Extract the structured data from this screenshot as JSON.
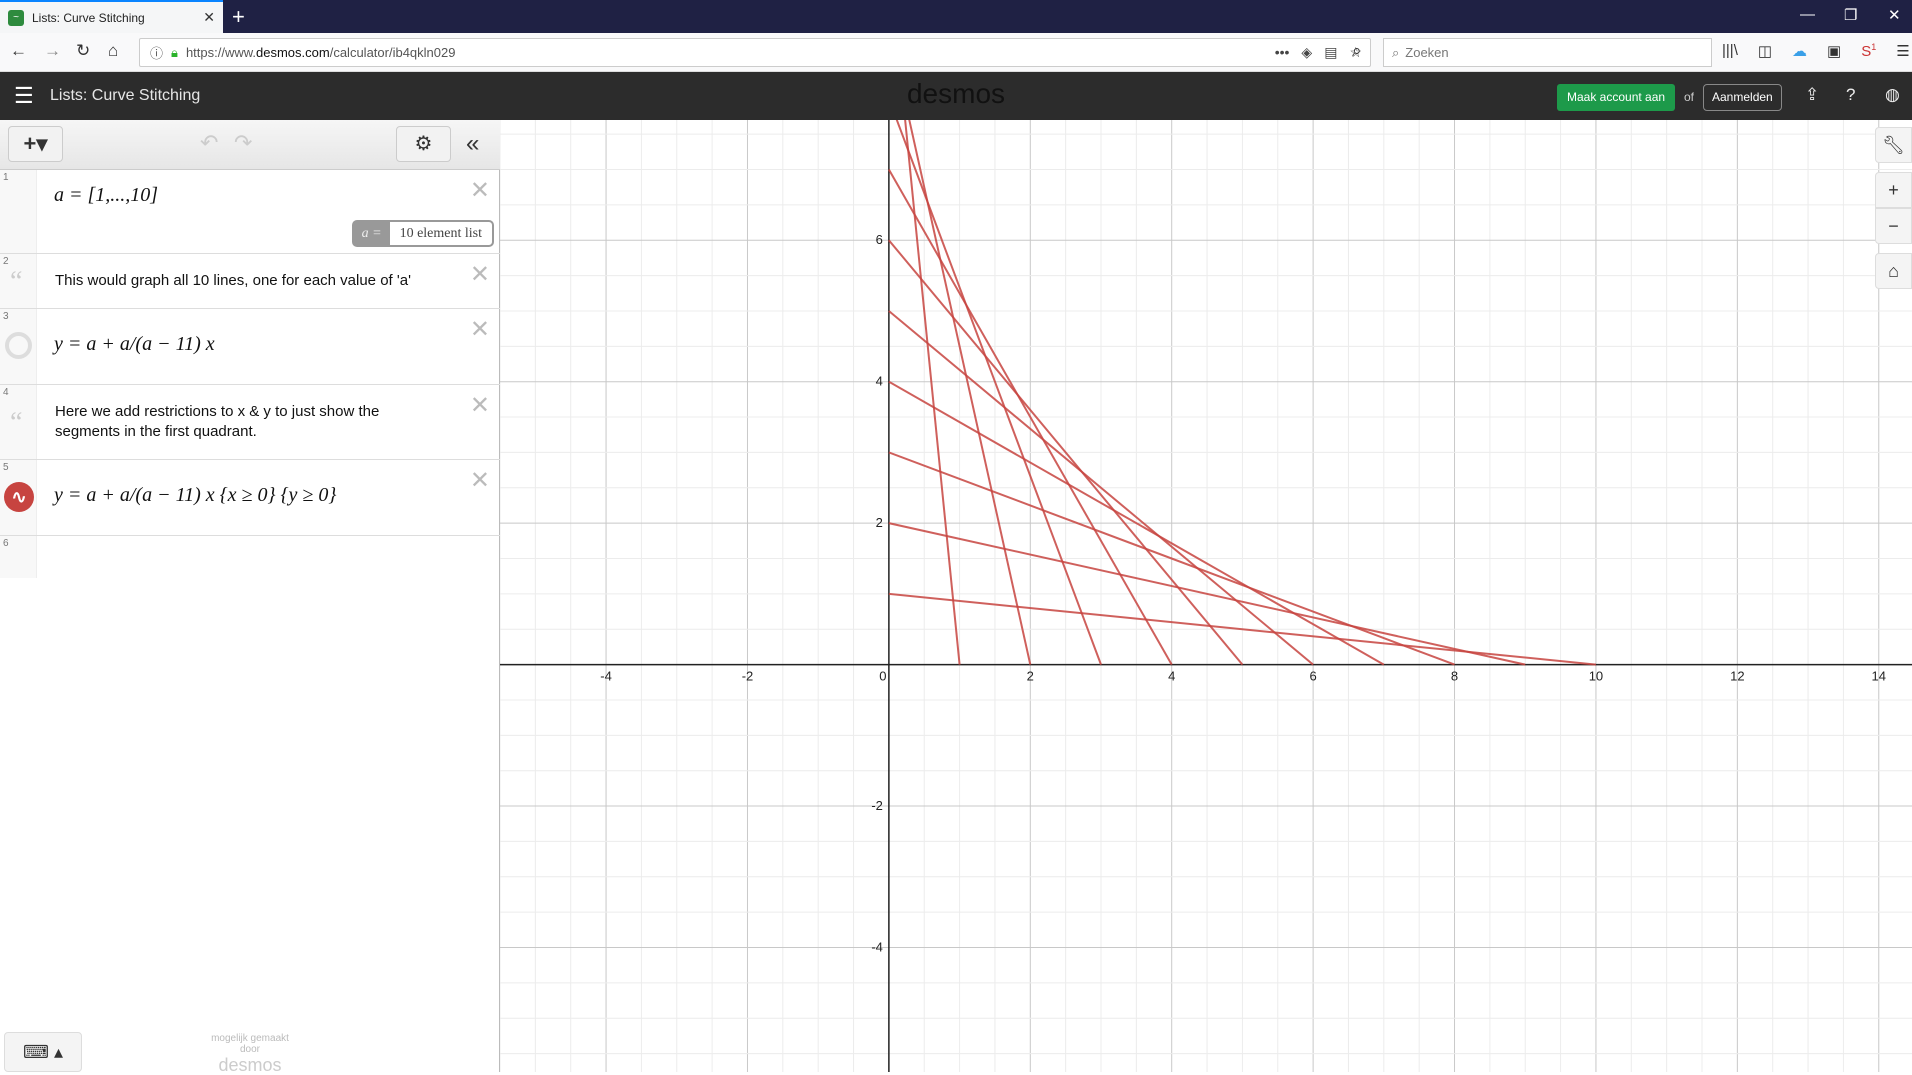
{
  "browser": {
    "tab_title": "Lists: Curve Stitching",
    "url_prefix": "https://www.",
    "url_domain": "desmos.com",
    "url_path": "/calculator/ib4qkln029",
    "search_placeholder": "Zoeken",
    "notification_badge": "1"
  },
  "header": {
    "title": "Lists: Curve Stitching",
    "logo": "desmos",
    "create_account": "Maak account aan",
    "or": "of",
    "login": "Aanmelden"
  },
  "expressions": [
    {
      "num": "1",
      "latex": "a = [1,...,10]",
      "list_label": "a =",
      "list_value": "10 element list"
    },
    {
      "num": "2",
      "note": "This would graph all 10 lines, one for each value of 'a'"
    },
    {
      "num": "3",
      "latex": "y = a + a/(a − 11) x",
      "hidden": true
    },
    {
      "num": "4",
      "note": "Here we add restrictions to x & y to just show the segments in the first quadrant."
    },
    {
      "num": "5",
      "latex": "y = a + a/(a − 11) x {x ≥ 0} {y ≥ 0}",
      "color": "#c74440"
    },
    {
      "num": "6"
    }
  ],
  "footer": {
    "powered1": "mogelijk gemaakt",
    "powered2": "door",
    "powered_logo": "desmos"
  },
  "graph": {
    "xlim": [
      -5.5,
      14.47
    ],
    "ylim": [
      -5.76,
      7.7
    ],
    "x_ticks": [
      -4,
      -2,
      0,
      2,
      4,
      6,
      8,
      10,
      12,
      14
    ],
    "y_ticks": [
      -4,
      -2,
      2,
      4,
      6
    ],
    "a_values": [
      1,
      2,
      3,
      4,
      5,
      6,
      7,
      8,
      9,
      10
    ],
    "line_color": "#c74440"
  }
}
